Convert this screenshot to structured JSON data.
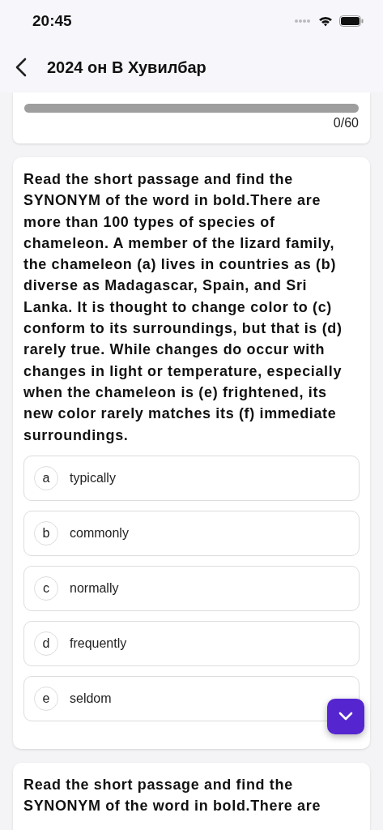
{
  "status_bar": {
    "time": "20:45"
  },
  "nav": {
    "title": "2024 он В Хувилбар"
  },
  "progress": {
    "level": 0,
    "reading": "0/60"
  },
  "questions": [
    {
      "text": "Read the short passage and find the SYNONYM of the word in bold.There are more than 100 types of species of chameleon. A member of the lizard family, the chameleon (a) lives in countries as (b) diverse as Madagascar, Spain, and Sri Lanka. It is thought to change color to (c) conform to its surroundings, but that is (d) rarely true. While changes do occur with changes in light or temperature, especially when the chameleon is (e) frightened, its new color rarely matches its (f) immediate surroundings.",
      "options": [
        {
          "letter": "a",
          "label": "typically",
          "selected": false
        },
        {
          "letter": "b",
          "label": "commonly",
          "selected": false
        },
        {
          "letter": "c",
          "label": "normally",
          "selected": false
        },
        {
          "letter": "d",
          "label": "frequently",
          "selected": false
        },
        {
          "letter": "e",
          "label": "seldom",
          "selected": false
        }
      ]
    },
    {
      "text": "Read the short passage and find the SYNONYM of the word in bold.There are"
    }
  ]
}
